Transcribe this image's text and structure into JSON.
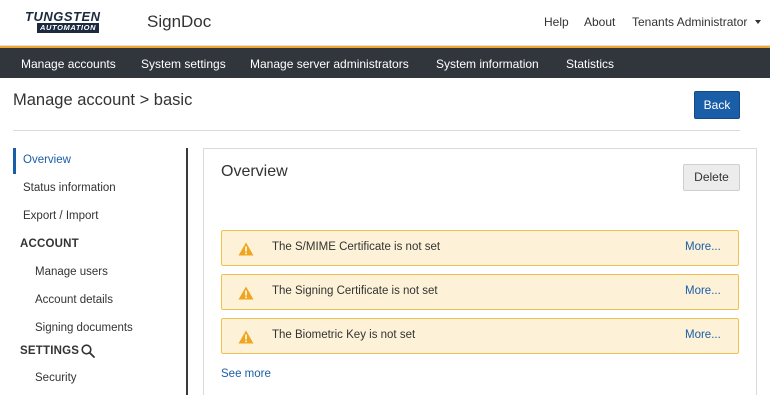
{
  "header": {
    "logo_line1": "TUNGSTEN",
    "logo_line2": "AUTOMATION",
    "app_name": "SignDoc",
    "help": "Help",
    "about": "About",
    "user_menu": "Tenants Administrator"
  },
  "menu": {
    "items": [
      {
        "label": "Manage accounts"
      },
      {
        "label": "System settings"
      },
      {
        "label": "Manage server administrators"
      },
      {
        "label": "System information"
      },
      {
        "label": "Statistics"
      }
    ]
  },
  "page": {
    "title": "Manage account > basic",
    "back_label": "Back"
  },
  "sidebar": {
    "items": [
      {
        "label": "Overview",
        "active": true
      },
      {
        "label": "Status information"
      },
      {
        "label": "Export / Import"
      }
    ],
    "account_section": "ACCOUNT",
    "account_items": [
      {
        "label": "Manage users"
      },
      {
        "label": "Account details"
      },
      {
        "label": "Signing documents"
      }
    ],
    "settings_section": "SETTINGS",
    "settings_items": [
      {
        "label": "Security"
      }
    ]
  },
  "panel": {
    "title": "Overview",
    "delete_label": "Delete",
    "alerts": [
      {
        "message": "The S/MIME Certificate is not set",
        "link": "More..."
      },
      {
        "message": "The Signing Certificate is not set",
        "link": "More..."
      },
      {
        "message": "The Biometric Key is not set",
        "link": "More..."
      }
    ],
    "see_more": "See more"
  },
  "colors": {
    "accent": "#1a5ea8",
    "menubar": "#31363d",
    "menubar_border": "#f0a82e",
    "alert_bg": "#fdf2d7",
    "alert_border": "#f0c24b",
    "warning_icon": "#f0a51e"
  },
  "icons": {
    "dropdown": "chevron-down-icon",
    "search": "search-icon",
    "warning": "warning-icon"
  }
}
